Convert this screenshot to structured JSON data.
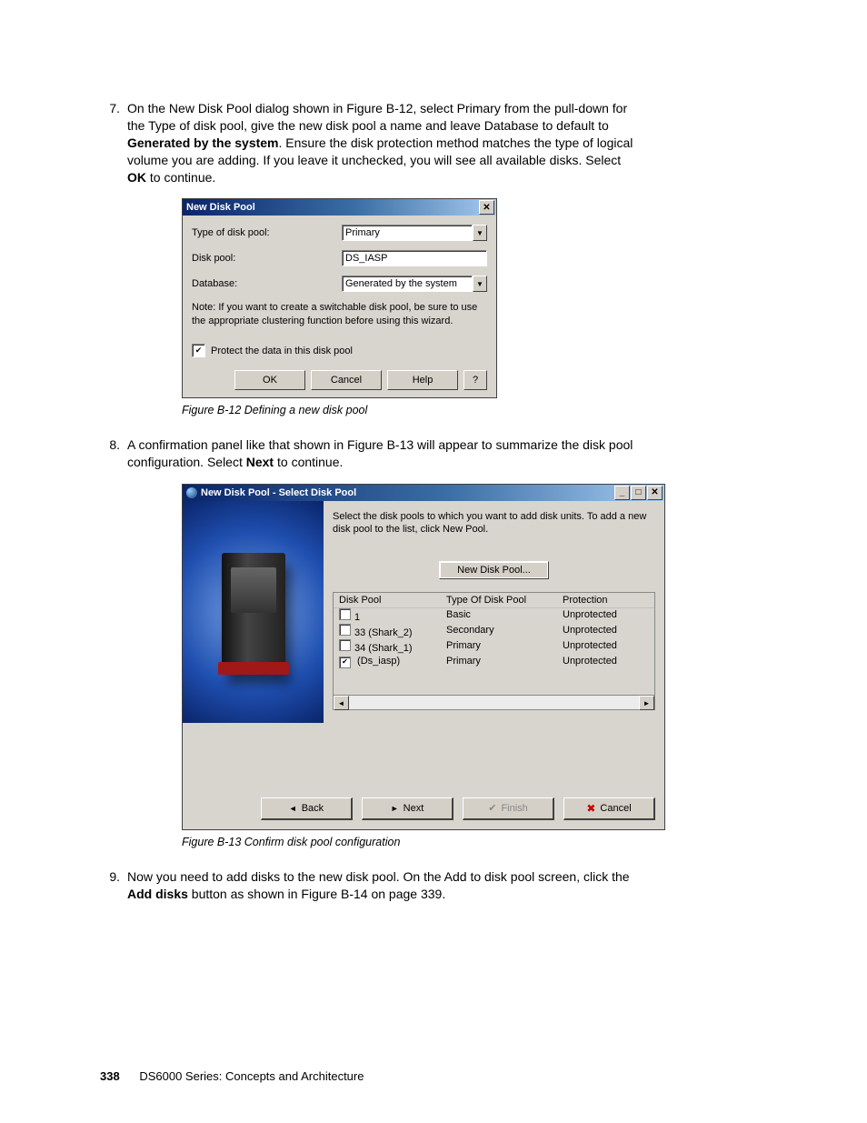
{
  "step7": {
    "num": "7.",
    "l1": "On the New Disk Pool dialog shown in Figure B-12, select Primary from the pull-down for",
    "l2": "the Type of disk pool, give the new disk pool a name and leave Database to default to",
    "b3": "Generated by the system",
    "l3": ". Ensure the disk protection method matches the type of logical",
    "l4": "volume you are adding. If you leave it unchecked, you will see all available disks. Select",
    "b5": "OK",
    "l5": " to continue."
  },
  "dialog1": {
    "title": "New Disk Pool",
    "close": "✕",
    "lbl_type": "Type of disk pool:",
    "val_type": "Primary",
    "lbl_pool": "Disk pool:",
    "val_pool": "DS_IASP",
    "lbl_db": "Database:",
    "val_db": "Generated by the system",
    "note": "Note:  If you want to create a switchable disk pool, be sure to use the appropriate clustering function before using this wizard.",
    "protect": "Protect the data in this disk pool",
    "ok": "OK",
    "cancel": "Cancel",
    "help": "Help",
    "q": "?"
  },
  "cap12": "Figure B-12   Defining a new disk pool",
  "step8": {
    "num": "8.",
    "l1": "A confirmation panel like that shown in Figure B-13 will appear to summarize the disk pool",
    "l2a": "configuration. Select ",
    "b2": "Next",
    "l2b": " to continue."
  },
  "dialog2": {
    "title": "New Disk Pool - Select Disk Pool",
    "min": "_",
    "max": "□",
    "close": "✕",
    "instr": "Select the disk pools to which you want to add disk units.  To add a new disk pool to the list, click New Pool.",
    "newpool": "New Disk Pool...",
    "h1": "Disk Pool",
    "h2": "Type Of Disk Pool",
    "h3": "Protection",
    "rows": [
      {
        "cb": false,
        "c1": "1",
        "c2": "Basic",
        "c3": "Unprotected"
      },
      {
        "cb": false,
        "c1": "33 (Shark_2)",
        "c2": "Secondary",
        "c3": "Unprotected"
      },
      {
        "cb": false,
        "c1": "34 (Shark_1)",
        "c2": "Primary",
        "c3": "Unprotected"
      },
      {
        "cb": true,
        "c1": "   (Ds_iasp)",
        "c2": "Primary",
        "c3": "Unprotected"
      }
    ],
    "back": "Back",
    "next": "Next",
    "finish": "Finish",
    "cancel": "Cancel"
  },
  "cap13": "Figure B-13   Confirm disk pool configuration",
  "step9": {
    "num": "9.",
    "l1": "Now you need to add disks to the new disk pool. On the Add to disk pool screen, click the",
    "b2": "Add disks",
    "l2": " button as shown in Figure B-14 on page 339."
  },
  "footer": {
    "page": "338",
    "title": "DS6000 Series: Concepts and Architecture"
  }
}
